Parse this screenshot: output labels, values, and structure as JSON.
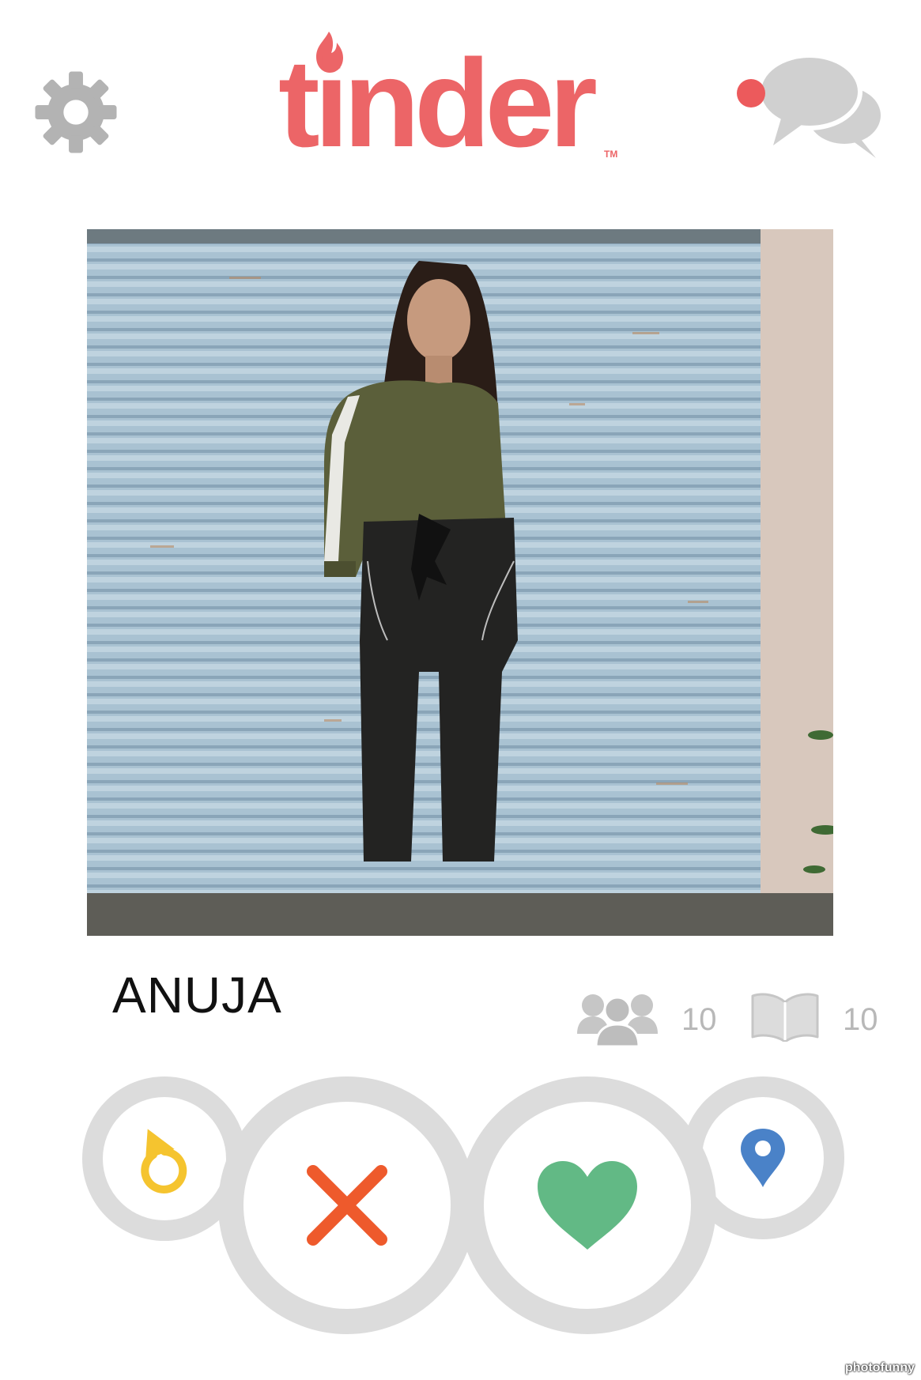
{
  "header": {
    "settings_icon": "gear-icon",
    "logo_text": "tinder",
    "logo_tm": "TM",
    "messages_icon": "chat-bubbles-icon",
    "has_unread_messages": true
  },
  "profile": {
    "name": "ANUJA",
    "photo_alt": "",
    "friends_count": "10",
    "interests_count": "10"
  },
  "actions": {
    "rewind_icon": "rewind-icon",
    "nope_icon": "x-icon",
    "like_icon": "heart-icon",
    "boost_icon": "location-pin-icon"
  },
  "colors": {
    "brand": "#ec6567",
    "icon_gray": "#b8b8b8",
    "ring_gray": "#dcdcdc",
    "rewind": "#f5c42f",
    "nope": "#ee5a2c",
    "like": "#62b985",
    "boost": "#4a82c8"
  },
  "watermark": "photofunny"
}
